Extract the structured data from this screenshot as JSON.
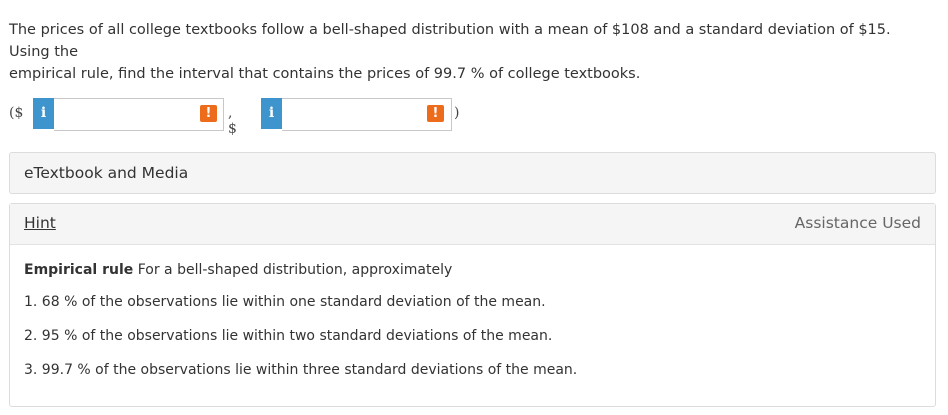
{
  "question": {
    "line1": "The prices of all college textbooks follow a bell-shaped distribution with a mean of $108 and a standard deviation of $15. Using the",
    "line2": "empirical rule, find the interval that contains the prices of 99.7 % of college textbooks."
  },
  "answer": {
    "open_paren": "($",
    "separator": ", $",
    "close_paren": ")",
    "info_glyph": "i",
    "warning_glyph": "!",
    "lower_value": "",
    "upper_value": ""
  },
  "etextbook": {
    "label": "eTextbook and Media"
  },
  "hint": {
    "link_label": "Hint",
    "status": "Assistance Used",
    "rule_title": "Empirical rule",
    "rule_intro": "For a bell-shaped distribution, approximately",
    "items": [
      "1. 68 %  of the observations lie within one standard deviation of the mean.",
      "2. 95 %  of the observations lie within two standard deviations of the mean.",
      "3. 99.7 %  of the observations lie within three standard deviations of the mean."
    ]
  },
  "colors": {
    "info_button": "#3e95cd",
    "warning_badge": "#ec6c1c"
  }
}
